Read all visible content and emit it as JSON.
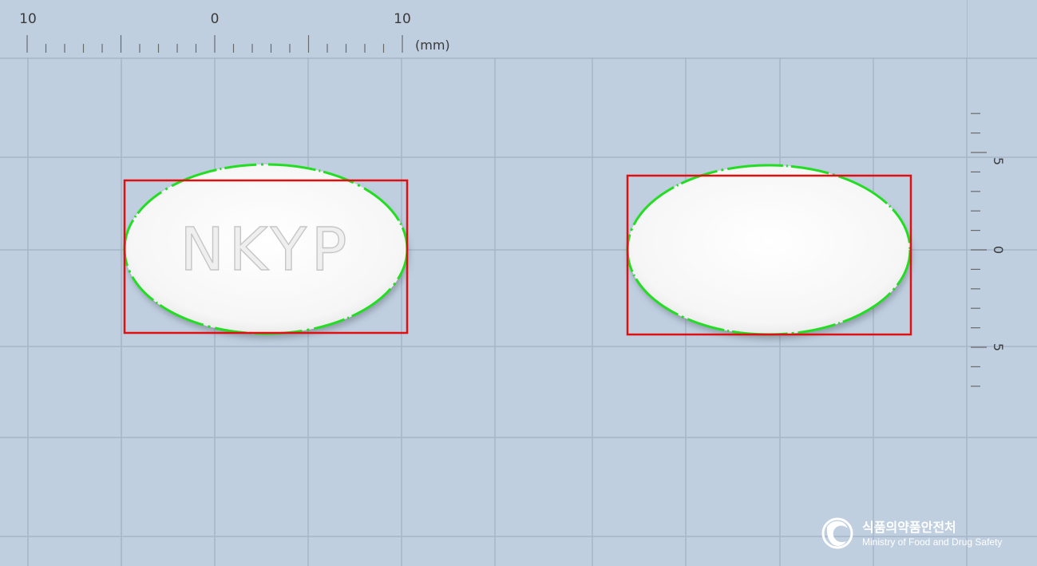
{
  "ruler_top": {
    "labels": [
      "10",
      "0",
      "10"
    ],
    "unit": "(mm)"
  },
  "ruler_right": {
    "labels": [
      "5",
      "0",
      "5"
    ]
  },
  "tablets": [
    {
      "side": "front",
      "imprint": "NKYP",
      "color": "#ffffff"
    },
    {
      "side": "back",
      "imprint": "",
      "color": "#ffffff"
    }
  ],
  "colors": {
    "background": "#bfcfe0",
    "grid": "#a6b6c8",
    "bounding_box": "#e01010",
    "contour": "#22dd22"
  },
  "logo": {
    "korean_text": "식품의약품안전처",
    "english_text": "Ministry of Food and Drug Safety"
  }
}
